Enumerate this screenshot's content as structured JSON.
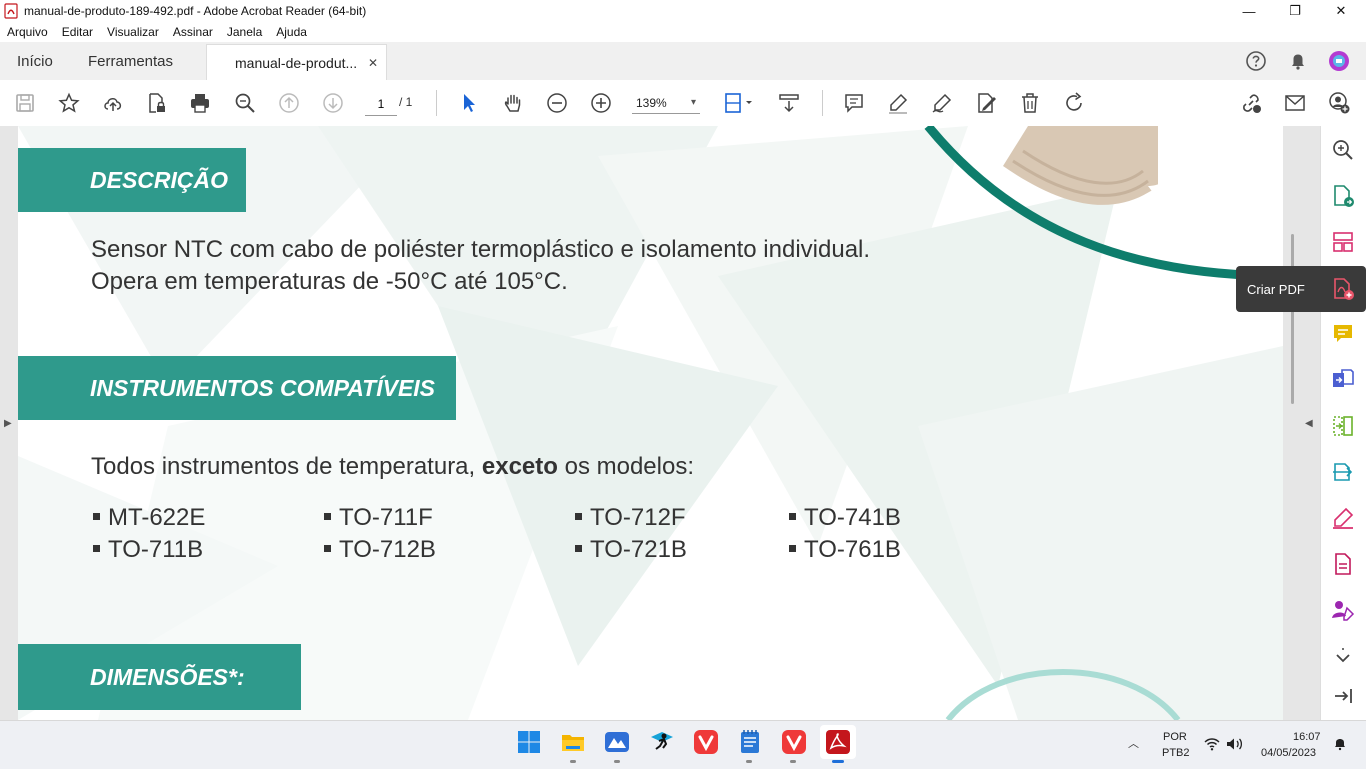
{
  "window": {
    "title": "manual-de-produto-189-492.pdf - Adobe Acrobat Reader (64-bit)",
    "minimize": "—",
    "maximize": "❐",
    "close": "✕"
  },
  "menu": [
    "Arquivo",
    "Editar",
    "Visualizar",
    "Assinar",
    "Janela",
    "Ajuda"
  ],
  "tabs": {
    "home": "Início",
    "tools": "Ferramentas",
    "document": "manual-de-produt...",
    "close": "✕"
  },
  "toolbar": {
    "page_current": "1",
    "page_total": "/ 1",
    "zoom": "139%",
    "zoom_caret": "▾"
  },
  "document": {
    "sections": [
      {
        "heading": "DESCRIÇÃO"
      },
      {
        "heading": "INSTRUMENTOS COMPATÍVEIS"
      },
      {
        "heading": "DIMENSÕES*:"
      }
    ],
    "description_line1": "Sensor NTC com cabo de poliéster termoplástico e isolamento individual.",
    "description_line2": "Opera em temperaturas de -50°C até 105°C.",
    "compat_prefix": "Todos instrumentos de temperatura, ",
    "compat_bold": "exceto",
    "compat_suffix": " os modelos:",
    "models": [
      "MT-622E",
      "TO-711B",
      "TO-711F",
      "TO-712B",
      "TO-712F",
      "TO-721B",
      "TO-741B",
      "TO-761B"
    ]
  },
  "right_panel": {
    "tooltip": "Criar PDF"
  },
  "taskbar": {
    "lang1": "POR",
    "lang2": "PTB2",
    "time": "16:07",
    "date": "04/05/2023"
  },
  "colors": {
    "section_teal": "#2f9a8c",
    "acrobat_red": "#c4161c",
    "tool_blue": "#1a64d6"
  }
}
